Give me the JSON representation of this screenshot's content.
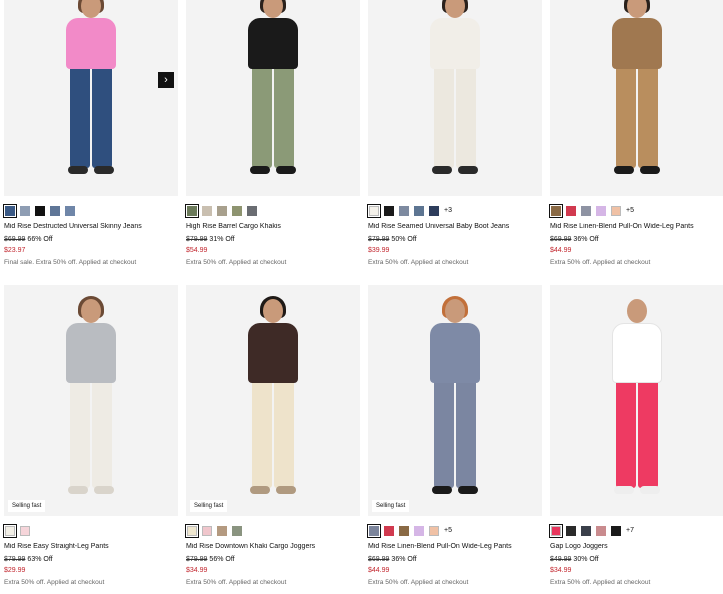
{
  "products": [
    {
      "name": "Mid Rise Destructed Universal Skinny Jeans",
      "was": "$69.99",
      "off": "66% Off",
      "now": "$23.97",
      "note": "Final sale. Extra 50% off. Applied at checkout",
      "badge": "",
      "more": "",
      "swatches": [
        "#3b5a86",
        "#8e9db3",
        "#111111",
        "#5f7697",
        "#6f86a8"
      ],
      "colors": {
        "top": "#f28ac8",
        "legs": "#2f4f7e",
        "shoe": "#2a2a2a",
        "hair": "#6b4a35"
      }
    },
    {
      "name": "High Rise Barrel Cargo Khakis",
      "was": "$79.99",
      "off": "31% Off",
      "now": "$54.99",
      "note": "Extra 50% off. Applied at checkout",
      "badge": "",
      "more": "",
      "swatches": [
        "#6b7a5a",
        "#c9bfb0",
        "#a8a08d",
        "#8e9470",
        "#6a6d72"
      ],
      "colors": {
        "top": "#1a1a1a",
        "legs": "#8b9a77",
        "shoe": "#1a1a1a",
        "hair": "#2a211c"
      }
    },
    {
      "name": "Mid Rise Seamed Universal Baby Boot Jeans",
      "was": "$79.99",
      "off": "50% Off",
      "now": "$39.99",
      "note": "Extra 50% off. Applied at checkout",
      "badge": "",
      "more": "+3",
      "swatches": [
        "#f4f1ea",
        "#1a1a1a",
        "#7d8aa0",
        "#5d7592",
        "#2e3d5c"
      ],
      "colors": {
        "top": "#f1eee8",
        "legs": "#ece8df",
        "shoe": "#2a2a2a",
        "hair": "#2a211c"
      }
    },
    {
      "name": "Mid Rise Linen-Blend Pull-On Wide-Leg Pants",
      "was": "$69.99",
      "off": "36% Off",
      "now": "$44.99",
      "note": "Extra 50% off. Applied at checkout",
      "badge": "",
      "more": "+5",
      "swatches": [
        "#8a6a45",
        "#d13a4f",
        "#8e93a3",
        "#d5b6e6",
        "#f0c1a5"
      ],
      "colors": {
        "top": "#a07850",
        "legs": "#b98e5e",
        "shoe": "#1a1a1a",
        "hair": "#2a211c"
      }
    },
    {
      "name": "Mid Rise Easy Straight-Leg Pants",
      "was": "$79.99",
      "off": "63% Off",
      "now": "$29.99",
      "note": "Extra 50% off. Applied at checkout",
      "badge": "Selling fast",
      "more": "",
      "swatches": [
        "#f2efe6",
        "#f6d5da"
      ],
      "colors": {
        "top": "#b9bcc1",
        "legs": "#eeebe4",
        "shoe": "#d9d4cb",
        "hair": "#6b4a35"
      }
    },
    {
      "name": "Mid Rise Downtown Khaki Cargo Joggers",
      "was": "$79.99",
      "off": "56% Off",
      "now": "$34.99",
      "note": "Extra 50% off. Applied at checkout",
      "badge": "Selling fast",
      "more": "",
      "swatches": [
        "#efe7cf",
        "#f0c6cc",
        "#b49a80",
        "#8a9480"
      ],
      "colors": {
        "top": "#3e2a26",
        "legs": "#eee3cb",
        "shoe": "#b09a80",
        "hair": "#1f1a17"
      }
    },
    {
      "name": "Mid Rise Linen-Blend Pull-On Wide-Leg Pants",
      "was": "$69.99",
      "off": "36% Off",
      "now": "$44.99",
      "note": "Extra 50% off. Applied at checkout",
      "badge": "Selling fast",
      "more": "+5",
      "swatches": [
        "#7c859c",
        "#d13a4f",
        "#8a6a45",
        "#d5b6e6",
        "#f0c1a5"
      ],
      "colors": {
        "top": "#7e8aa6",
        "legs": "#7b86a1",
        "shoe": "#1a1a1a",
        "hair": "#c2703a"
      }
    },
    {
      "name": "Gap Logo Joggers",
      "was": "$49.99",
      "off": "30% Off",
      "now": "$34.99",
      "note": "Extra 50% off. Applied at checkout",
      "badge": "",
      "more": "+7",
      "swatches": [
        "#e8365d",
        "#2a2a2a",
        "#3a3f4a",
        "#c98b8e",
        "#1a1a1a"
      ],
      "colors": {
        "top": "#ffffff",
        "legs": "#ee3a62",
        "shoe": "#eeeeee",
        "hair": "#f3f3f3"
      }
    }
  ],
  "next_arrow_icon": "chevron-right-icon"
}
